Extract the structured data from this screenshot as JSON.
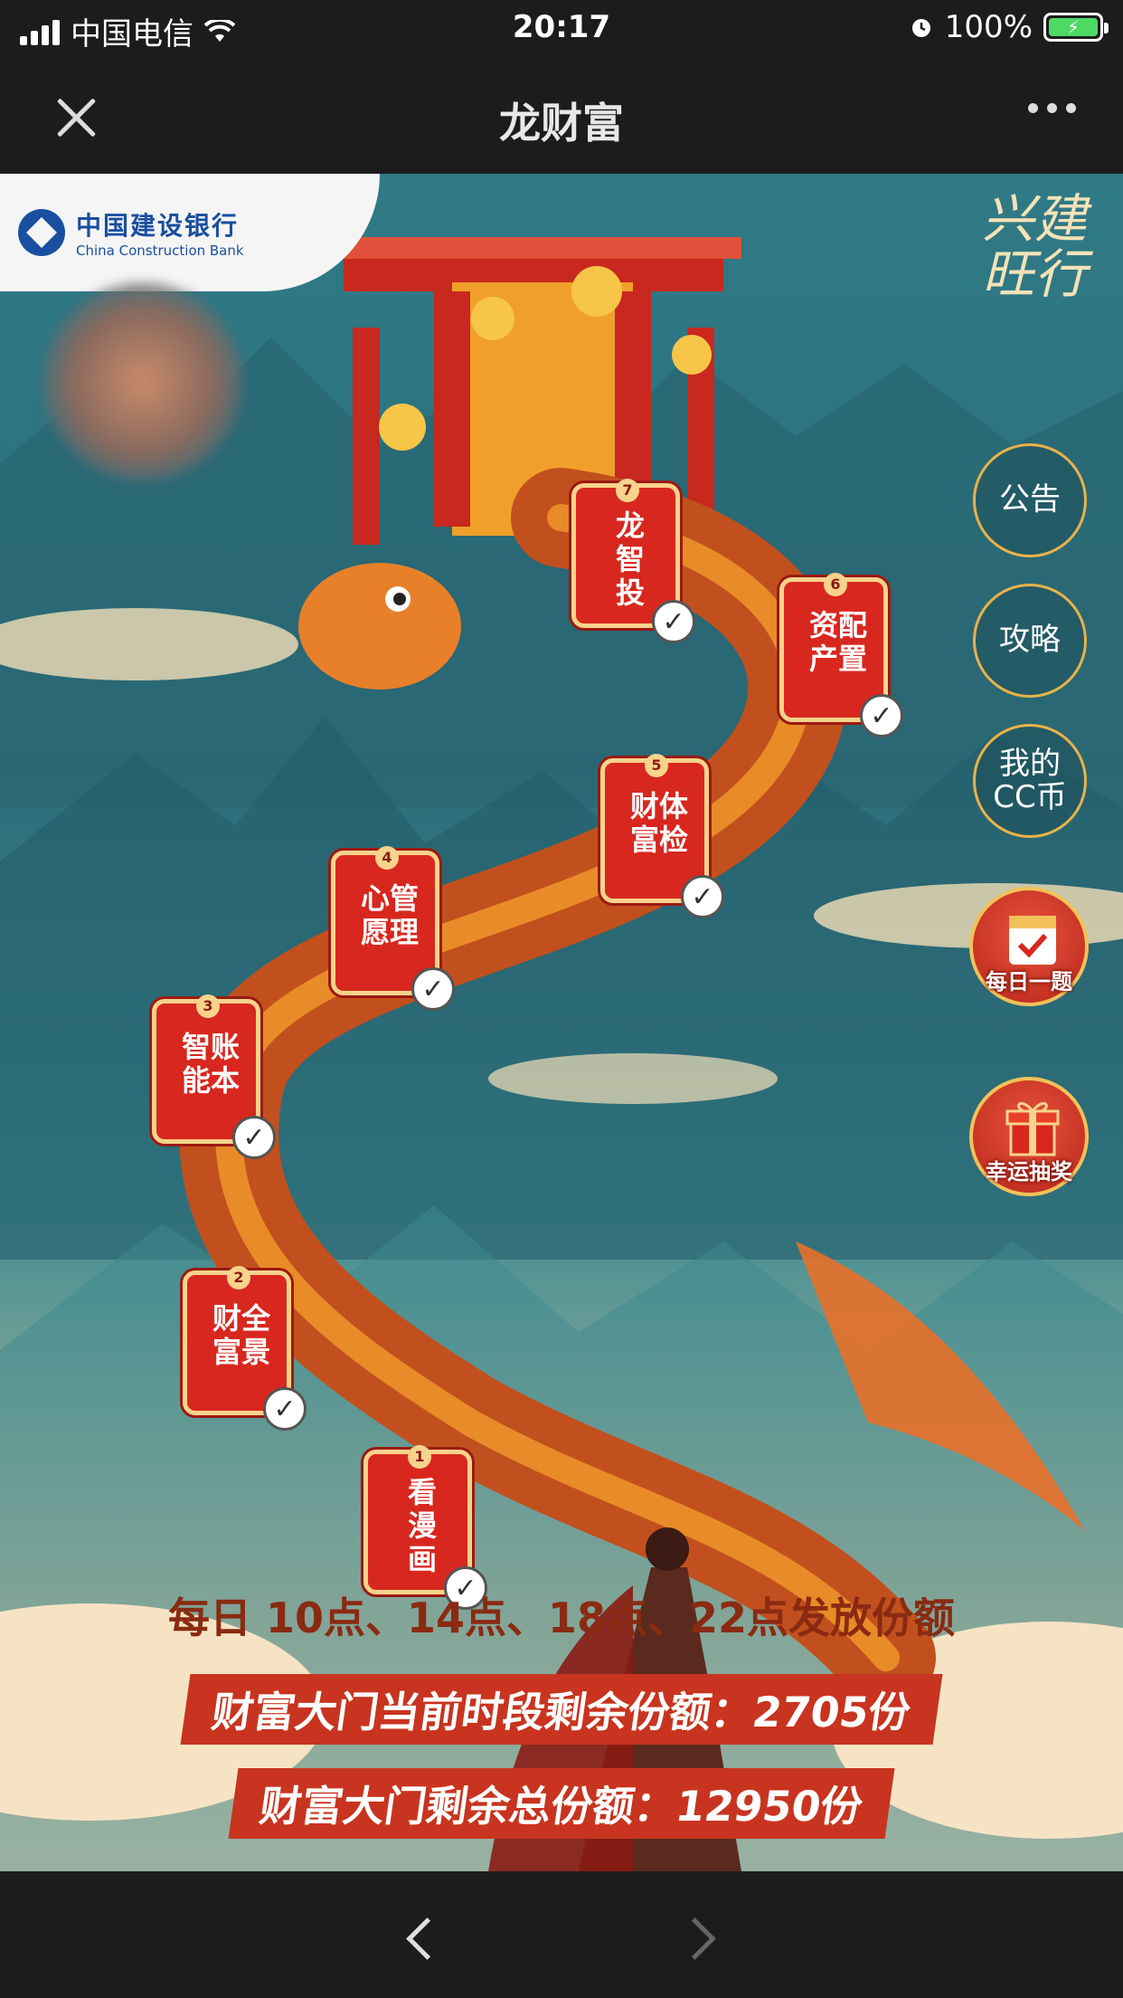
{
  "status_bar": {
    "carrier": "中国电信",
    "time": "20:17",
    "battery": "100%"
  },
  "nav": {
    "title": "龙财富"
  },
  "header": {
    "bank_name_cn": "中国建设银行",
    "bank_name_en": "China Construction Bank",
    "slogan": "兴建旺行"
  },
  "side_buttons": [
    {
      "label": "公告"
    },
    {
      "label": "攻略"
    },
    {
      "label": "我的CC币"
    }
  ],
  "icon_buttons": [
    {
      "label": "每日一题",
      "icon": "calendar-check-icon"
    },
    {
      "label": "幸运抽奖",
      "icon": "gift-icon"
    }
  ],
  "steps": [
    {
      "num": "1",
      "text": "看漫画",
      "done": true
    },
    {
      "num": "2",
      "text": "财全富景",
      "done": true
    },
    {
      "num": "3",
      "text": "智账能本",
      "done": true
    },
    {
      "num": "4",
      "text": "心管愿理",
      "done": true
    },
    {
      "num": "5",
      "text": "财体富检",
      "done": true
    },
    {
      "num": "6",
      "text": "资配产置",
      "done": true
    },
    {
      "num": "7",
      "text": "龙智投",
      "done": true
    }
  ],
  "footer": {
    "schedule": "每日 10点、14点、18点、22点发放份额",
    "current_quota": "财富大门当前时段剩余份额：2705份",
    "total_quota": "财富大门剩余总份额：12950份"
  },
  "colors": {
    "primary_red": "#d8271f",
    "gold": "#f7d38b",
    "teal_bg": "#2f7a86",
    "bank_blue": "#1a4fa0"
  }
}
